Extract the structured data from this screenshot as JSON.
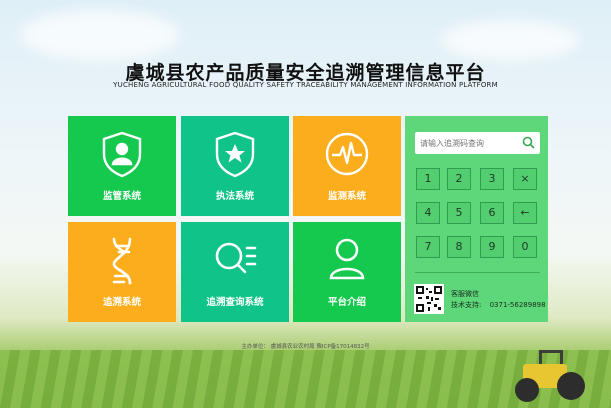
{
  "header": {
    "title": "虞城县农产品质量安全追溯管理信息平台",
    "subtitle": "YUCHENG AGRICULTURAL FOOD QUALITY SAFETY TRACEABILITY MANAGEMENT INFORMATION PLATFORM"
  },
  "tiles": [
    {
      "label": "监管系统",
      "icon": "supervisor-shield-icon",
      "color": "#14c94e"
    },
    {
      "label": "执法系统",
      "icon": "star-shield-icon",
      "color": "#10c388"
    },
    {
      "label": "监测系统",
      "icon": "pulse-monitor-icon",
      "color": "#fbad1c"
    },
    {
      "label": "追溯系统",
      "icon": "dna-icon",
      "color": "#fbad1c"
    },
    {
      "label": "追溯查询系统",
      "icon": "search-list-icon",
      "color": "#10c388"
    },
    {
      "label": "平台介绍",
      "icon": "user-icon",
      "color": "#14c94e"
    }
  ],
  "panel": {
    "search_placeholder": "请输入追溯码查询",
    "keys": [
      "1",
      "2",
      "3",
      "×",
      "4",
      "5",
      "6",
      "←",
      "7",
      "8",
      "9",
      "0"
    ],
    "contact_label": "客服微信",
    "support_label": "技术支持:",
    "support_phone": "0371-56289898"
  },
  "footer": {
    "text": "主办单位：    虞城县农业农村局    豫ICP备17014832号"
  },
  "colors": {
    "green": "#14c94e",
    "teal": "#10c388",
    "orange": "#fbad1c",
    "panel": "#5dd77a"
  }
}
